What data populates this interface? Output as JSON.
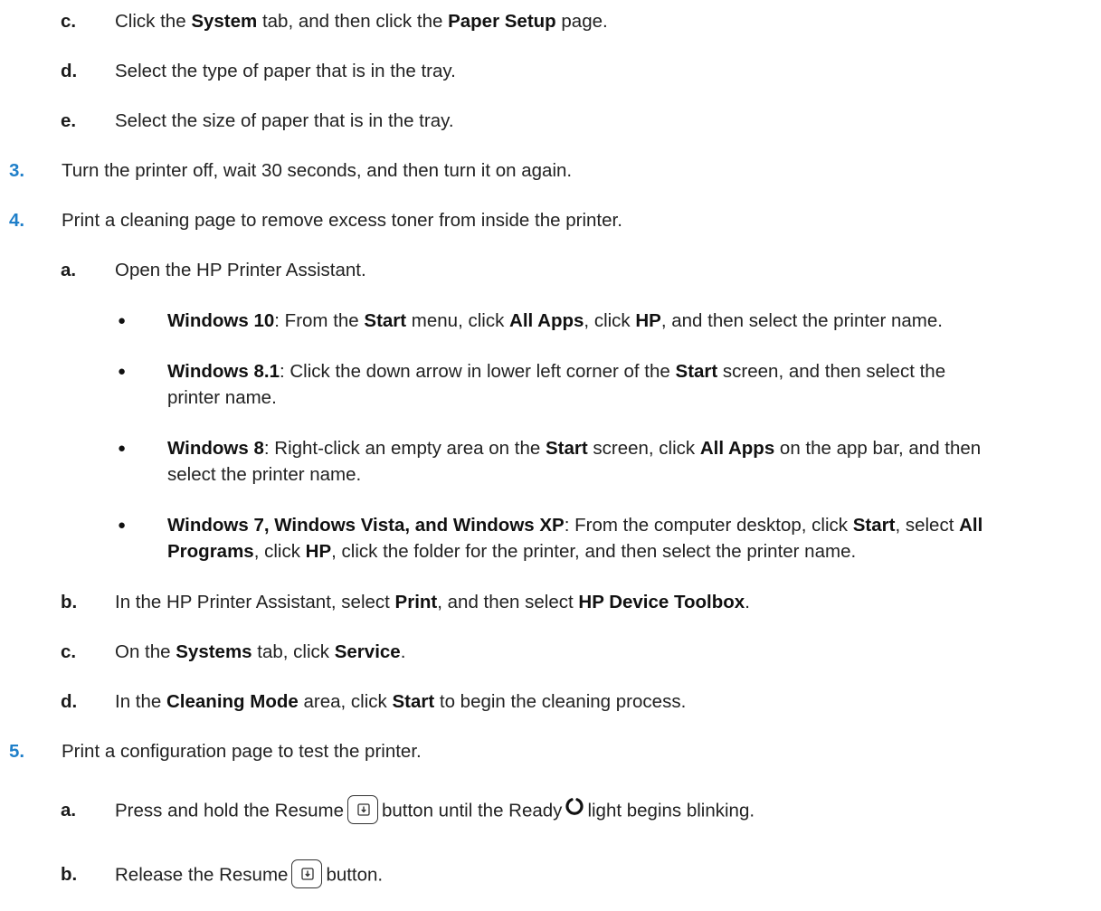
{
  "steps": {
    "c1": {
      "marker": "c.",
      "t1": "Click the ",
      "b1": "System",
      "t2": " tab, and then click the ",
      "b2": "Paper Setup",
      "t3": " page."
    },
    "d1": {
      "marker": "d.",
      "text": "Select the type of paper that is in the tray."
    },
    "e1": {
      "marker": "e.",
      "text": "Select the size of paper that is in the tray."
    },
    "s3": {
      "marker": "3.",
      "text": "Turn the printer off, wait 30 seconds, and then turn it on again."
    },
    "s4": {
      "marker": "4.",
      "text": "Print a cleaning page to remove excess toner from inside the printer."
    },
    "a4": {
      "marker": "a.",
      "text": "Open the HP Printer Assistant."
    },
    "w10": {
      "marker": "●",
      "b1": "Windows 10",
      "t1": ": From the ",
      "b2": "Start",
      "t2": " menu, click ",
      "b3": "All Apps",
      "t3": ", click ",
      "b4": "HP",
      "t4": ", and then select the printer name."
    },
    "w81": {
      "marker": "●",
      "b1": "Windows 8.1",
      "t1": ": Click the down arrow in lower left corner of the ",
      "b2": "Start",
      "t2": " screen, and then select the",
      "line2": "printer name."
    },
    "w8": {
      "marker": "●",
      "b1": "Windows 8",
      "t1": ": Right-click an empty area on the ",
      "b2": "Start",
      "t2": " screen, click ",
      "b3": "All Apps",
      "t3": " on the app bar, and then",
      "line2": "select the printer name."
    },
    "w7": {
      "marker": "●",
      "b1": "Windows 7, Windows Vista, and Windows XP",
      "t1": ": From the computer desktop, click ",
      "b2": "Start",
      "t2": ", select ",
      "b3": "All",
      "b4": "Programs",
      "t4": ", click ",
      "b5": "HP",
      "t5": ", click the folder for the printer, and then select the printer name."
    },
    "b4": {
      "marker": "b.",
      "t1": "In the HP Printer Assistant, select ",
      "b1": "Print",
      "t2": ", and then select ",
      "b2": "HP Device Toolbox",
      "t3": "."
    },
    "c4": {
      "marker": "c.",
      "t1": "On the ",
      "b1": "Systems",
      "t2": " tab, click ",
      "b2": "Service",
      "t3": "."
    },
    "d4": {
      "marker": "d.",
      "t1": "In the ",
      "b1": "Cleaning Mode",
      "t2": " area, click ",
      "b2": "Start",
      "t3": " to begin the cleaning process."
    },
    "s5": {
      "marker": "5.",
      "text": "Print a configuration page to test the printer."
    },
    "a5": {
      "marker": "a.",
      "t1": "Press and hold the Resume",
      "t2": "button until the Ready",
      "t3": "light begins blinking."
    },
    "b5": {
      "marker": "b.",
      "t1": "Release the Resume",
      "t2": "button."
    }
  },
  "icons": {
    "resume": "resume-button-icon",
    "ready": "ready-light-icon"
  },
  "colors": {
    "step_number": "#1f7fc9",
    "text": "#222222"
  }
}
